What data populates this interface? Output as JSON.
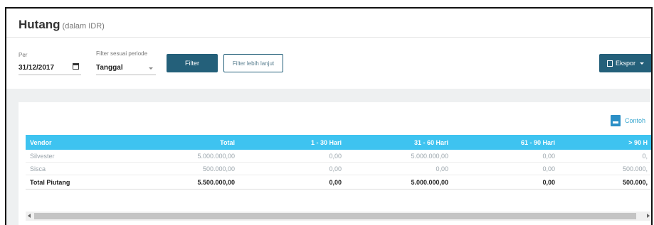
{
  "header": {
    "title": "Hutang",
    "subtitle": "(dalam IDR)"
  },
  "filters": {
    "per_label": "Per",
    "per_value": "31/12/2017",
    "period_label": "Filter sesuai periode",
    "period_value": "Tanggal",
    "filter_button": "Filter",
    "more_filter_button": "Filter lebih lanjut",
    "export_button": "Ekspor"
  },
  "contoh_link": "Contoh",
  "table": {
    "columns": [
      "Vendor",
      "Total",
      "1 - 30 Hari",
      "31 - 60 Hari",
      "61 - 90 Hari",
      "> 90 H"
    ],
    "rows": [
      [
        "Silvester",
        "5.000.000,00",
        "0,00",
        "5.000.000,00",
        "0,00",
        "0,"
      ],
      [
        "Sisca",
        "500.000,00",
        "0,00",
        "0,00",
        "0,00",
        "500.000,"
      ]
    ],
    "total_row": [
      "Total Piutang",
      "5.500.000,00",
      "0,00",
      "5.000.000,00",
      "0,00",
      "500.000,"
    ]
  },
  "colors": {
    "header_bg": "#3ec3f0",
    "button_bg": "#24607a",
    "link": "#3aa7cf"
  },
  "icons": {
    "calendar": "calendar-icon",
    "export": "export-icon",
    "document": "doc-icon"
  }
}
